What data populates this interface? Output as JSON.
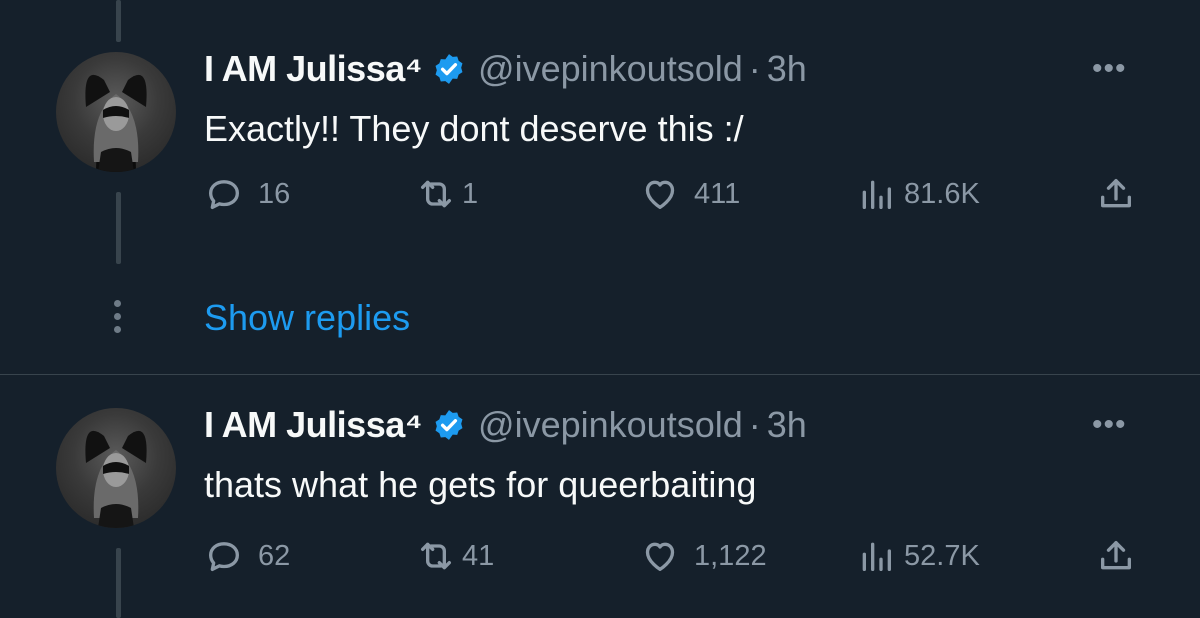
{
  "tweets": [
    {
      "name": "I AM Julissa⁴",
      "handle": "@ivepinkoutsold",
      "separator": "·",
      "time": "3h",
      "text": "Exactly!! They dont deserve this :/",
      "replies": "16",
      "retweets": "1",
      "likes": "411",
      "views": "81.6K",
      "more": "•••"
    },
    {
      "name": "I AM Julissa⁴",
      "handle": "@ivepinkoutsold",
      "separator": "·",
      "time": "3h",
      "text": "thats what he gets for queerbaiting",
      "replies": "62",
      "retweets": "41",
      "likes": "1,122",
      "views": "52.7K",
      "more": "•••"
    }
  ],
  "show_replies_label": "Show replies",
  "icons": {
    "verified": "verified-badge-icon",
    "reply": "reply-icon",
    "retweet": "retweet-icon",
    "like": "heart-icon",
    "views": "views-chart-icon",
    "share": "share-icon",
    "more": "more-dots-icon"
  },
  "colors": {
    "background": "#15202b",
    "text": "#f7f9f9",
    "secondary": "#8b98a5",
    "accent": "#1d9bf0",
    "line": "#38444d"
  }
}
